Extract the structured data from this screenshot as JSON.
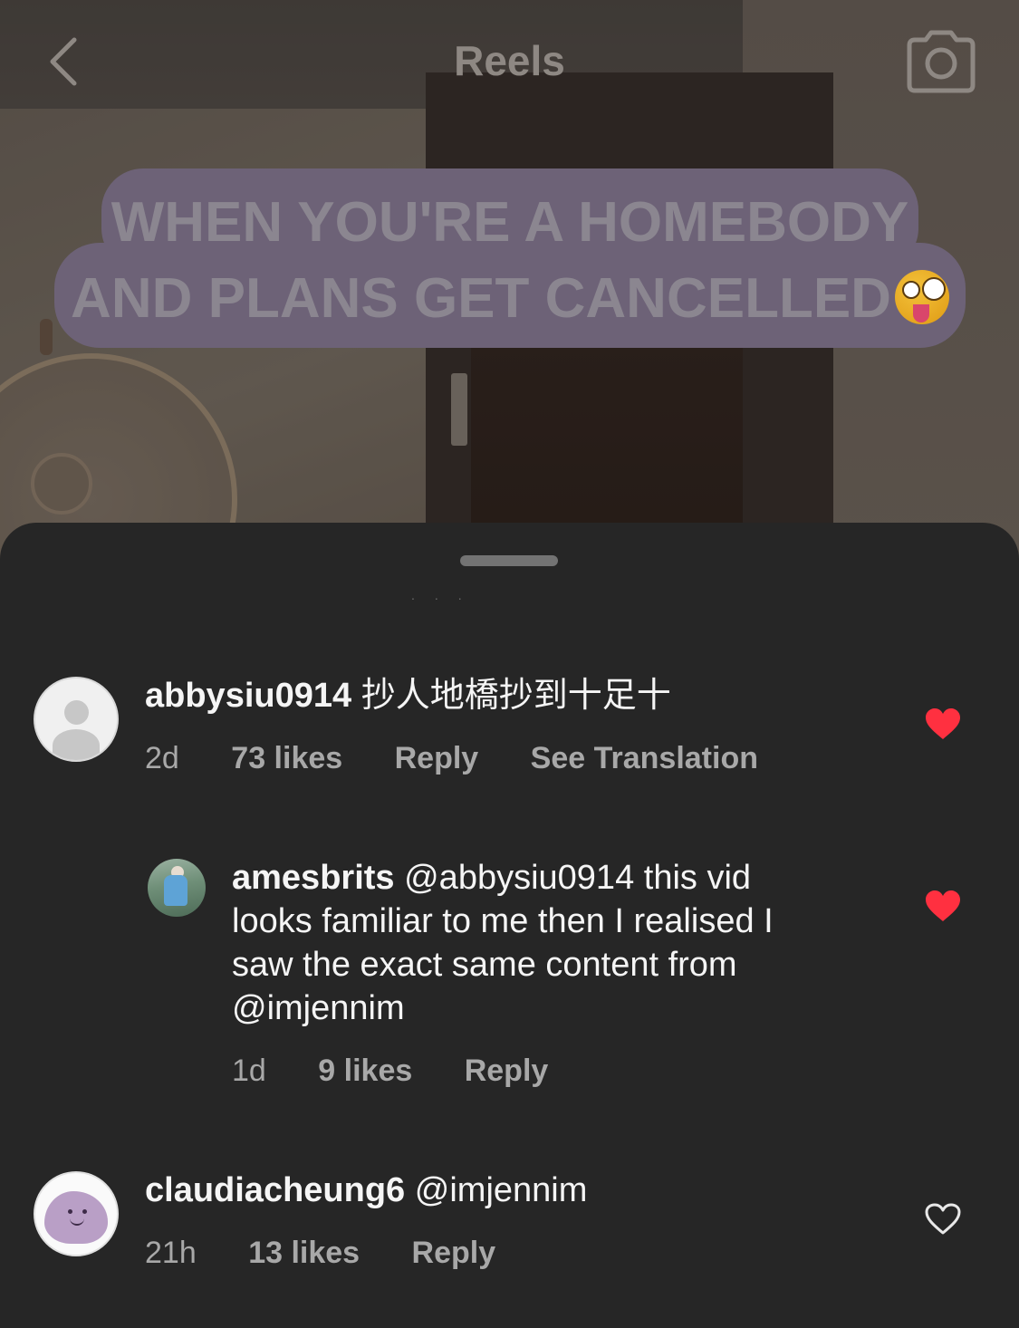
{
  "header": {
    "title": "Reels"
  },
  "video": {
    "caption_line1": "WHEN YOU'RE A HOMEBODY",
    "caption_line2": "AND PLANS GET CANCELLED",
    "caption_emoji": "zany-face-icon"
  },
  "comments": [
    {
      "username": "abbysiu0914",
      "text": "抄人地橋抄到十足十",
      "time": "2d",
      "likes": "73 likes",
      "reply_label": "Reply",
      "translate_label": "See Translation",
      "liked": true
    },
    {
      "username": "amesbrits",
      "mention": "@abbysiu0914",
      "text_line1": " this vid",
      "text_line2": "looks familiar to me then I realised I",
      "text_line3": "saw the exact same content from",
      "text_line4": "@imjennim",
      "time": "1d",
      "likes": "9 likes",
      "reply_label": "Reply",
      "liked": true
    },
    {
      "username": "claudiacheung6",
      "text": "@imjennim",
      "time": "21h",
      "likes": "13 likes",
      "reply_label": "Reply",
      "liked": false
    }
  ],
  "colors": {
    "sheet_bg": "#262626",
    "like_red": "#ff3040",
    "meta_gray": "#a8a8a8",
    "caption_bubble": "#6d6277"
  }
}
